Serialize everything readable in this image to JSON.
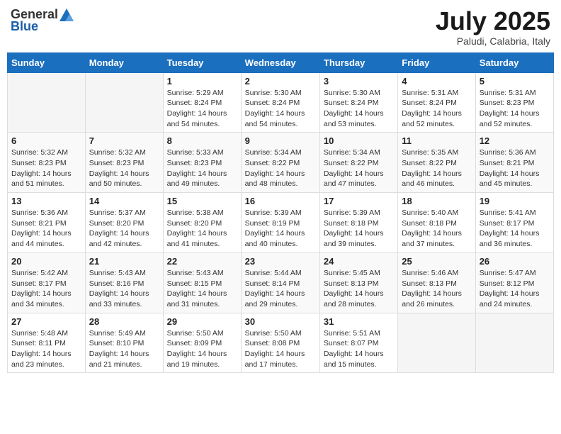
{
  "header": {
    "logo_general": "General",
    "logo_blue": "Blue",
    "month_title": "July 2025",
    "location": "Paludi, Calabria, Italy"
  },
  "days_of_week": [
    "Sunday",
    "Monday",
    "Tuesday",
    "Wednesday",
    "Thursday",
    "Friday",
    "Saturday"
  ],
  "weeks": [
    [
      {
        "num": "",
        "sunrise": "",
        "sunset": "",
        "daylight": ""
      },
      {
        "num": "",
        "sunrise": "",
        "sunset": "",
        "daylight": ""
      },
      {
        "num": "1",
        "sunrise": "Sunrise: 5:29 AM",
        "sunset": "Sunset: 8:24 PM",
        "daylight": "Daylight: 14 hours and 54 minutes."
      },
      {
        "num": "2",
        "sunrise": "Sunrise: 5:30 AM",
        "sunset": "Sunset: 8:24 PM",
        "daylight": "Daylight: 14 hours and 54 minutes."
      },
      {
        "num": "3",
        "sunrise": "Sunrise: 5:30 AM",
        "sunset": "Sunset: 8:24 PM",
        "daylight": "Daylight: 14 hours and 53 minutes."
      },
      {
        "num": "4",
        "sunrise": "Sunrise: 5:31 AM",
        "sunset": "Sunset: 8:24 PM",
        "daylight": "Daylight: 14 hours and 52 minutes."
      },
      {
        "num": "5",
        "sunrise": "Sunrise: 5:31 AM",
        "sunset": "Sunset: 8:23 PM",
        "daylight": "Daylight: 14 hours and 52 minutes."
      }
    ],
    [
      {
        "num": "6",
        "sunrise": "Sunrise: 5:32 AM",
        "sunset": "Sunset: 8:23 PM",
        "daylight": "Daylight: 14 hours and 51 minutes."
      },
      {
        "num": "7",
        "sunrise": "Sunrise: 5:32 AM",
        "sunset": "Sunset: 8:23 PM",
        "daylight": "Daylight: 14 hours and 50 minutes."
      },
      {
        "num": "8",
        "sunrise": "Sunrise: 5:33 AM",
        "sunset": "Sunset: 8:23 PM",
        "daylight": "Daylight: 14 hours and 49 minutes."
      },
      {
        "num": "9",
        "sunrise": "Sunrise: 5:34 AM",
        "sunset": "Sunset: 8:22 PM",
        "daylight": "Daylight: 14 hours and 48 minutes."
      },
      {
        "num": "10",
        "sunrise": "Sunrise: 5:34 AM",
        "sunset": "Sunset: 8:22 PM",
        "daylight": "Daylight: 14 hours and 47 minutes."
      },
      {
        "num": "11",
        "sunrise": "Sunrise: 5:35 AM",
        "sunset": "Sunset: 8:22 PM",
        "daylight": "Daylight: 14 hours and 46 minutes."
      },
      {
        "num": "12",
        "sunrise": "Sunrise: 5:36 AM",
        "sunset": "Sunset: 8:21 PM",
        "daylight": "Daylight: 14 hours and 45 minutes."
      }
    ],
    [
      {
        "num": "13",
        "sunrise": "Sunrise: 5:36 AM",
        "sunset": "Sunset: 8:21 PM",
        "daylight": "Daylight: 14 hours and 44 minutes."
      },
      {
        "num": "14",
        "sunrise": "Sunrise: 5:37 AM",
        "sunset": "Sunset: 8:20 PM",
        "daylight": "Daylight: 14 hours and 42 minutes."
      },
      {
        "num": "15",
        "sunrise": "Sunrise: 5:38 AM",
        "sunset": "Sunset: 8:20 PM",
        "daylight": "Daylight: 14 hours and 41 minutes."
      },
      {
        "num": "16",
        "sunrise": "Sunrise: 5:39 AM",
        "sunset": "Sunset: 8:19 PM",
        "daylight": "Daylight: 14 hours and 40 minutes."
      },
      {
        "num": "17",
        "sunrise": "Sunrise: 5:39 AM",
        "sunset": "Sunset: 8:18 PM",
        "daylight": "Daylight: 14 hours and 39 minutes."
      },
      {
        "num": "18",
        "sunrise": "Sunrise: 5:40 AM",
        "sunset": "Sunset: 8:18 PM",
        "daylight": "Daylight: 14 hours and 37 minutes."
      },
      {
        "num": "19",
        "sunrise": "Sunrise: 5:41 AM",
        "sunset": "Sunset: 8:17 PM",
        "daylight": "Daylight: 14 hours and 36 minutes."
      }
    ],
    [
      {
        "num": "20",
        "sunrise": "Sunrise: 5:42 AM",
        "sunset": "Sunset: 8:17 PM",
        "daylight": "Daylight: 14 hours and 34 minutes."
      },
      {
        "num": "21",
        "sunrise": "Sunrise: 5:43 AM",
        "sunset": "Sunset: 8:16 PM",
        "daylight": "Daylight: 14 hours and 33 minutes."
      },
      {
        "num": "22",
        "sunrise": "Sunrise: 5:43 AM",
        "sunset": "Sunset: 8:15 PM",
        "daylight": "Daylight: 14 hours and 31 minutes."
      },
      {
        "num": "23",
        "sunrise": "Sunrise: 5:44 AM",
        "sunset": "Sunset: 8:14 PM",
        "daylight": "Daylight: 14 hours and 29 minutes."
      },
      {
        "num": "24",
        "sunrise": "Sunrise: 5:45 AM",
        "sunset": "Sunset: 8:13 PM",
        "daylight": "Daylight: 14 hours and 28 minutes."
      },
      {
        "num": "25",
        "sunrise": "Sunrise: 5:46 AM",
        "sunset": "Sunset: 8:13 PM",
        "daylight": "Daylight: 14 hours and 26 minutes."
      },
      {
        "num": "26",
        "sunrise": "Sunrise: 5:47 AM",
        "sunset": "Sunset: 8:12 PM",
        "daylight": "Daylight: 14 hours and 24 minutes."
      }
    ],
    [
      {
        "num": "27",
        "sunrise": "Sunrise: 5:48 AM",
        "sunset": "Sunset: 8:11 PM",
        "daylight": "Daylight: 14 hours and 23 minutes."
      },
      {
        "num": "28",
        "sunrise": "Sunrise: 5:49 AM",
        "sunset": "Sunset: 8:10 PM",
        "daylight": "Daylight: 14 hours and 21 minutes."
      },
      {
        "num": "29",
        "sunrise": "Sunrise: 5:50 AM",
        "sunset": "Sunset: 8:09 PM",
        "daylight": "Daylight: 14 hours and 19 minutes."
      },
      {
        "num": "30",
        "sunrise": "Sunrise: 5:50 AM",
        "sunset": "Sunset: 8:08 PM",
        "daylight": "Daylight: 14 hours and 17 minutes."
      },
      {
        "num": "31",
        "sunrise": "Sunrise: 5:51 AM",
        "sunset": "Sunset: 8:07 PM",
        "daylight": "Daylight: 14 hours and 15 minutes."
      },
      {
        "num": "",
        "sunrise": "",
        "sunset": "",
        "daylight": ""
      },
      {
        "num": "",
        "sunrise": "",
        "sunset": "",
        "daylight": ""
      }
    ]
  ]
}
